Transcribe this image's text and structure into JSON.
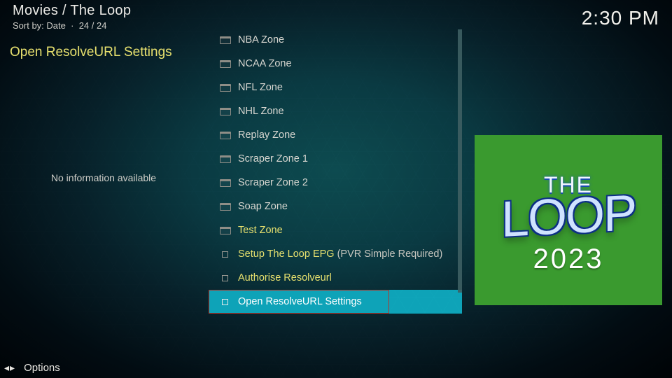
{
  "header": {
    "breadcrumb": "Movies / The Loop",
    "sort_prefix": "Sort by: ",
    "sort_field": "Date",
    "count": "24 / 24"
  },
  "clock": "2:30 PM",
  "left": {
    "title": "Open ResolveURL Settings",
    "no_info": "No information available"
  },
  "list": {
    "items": [
      {
        "label": "NBA Zone",
        "icon": "folder",
        "accent": false,
        "extra": ""
      },
      {
        "label": "NCAA Zone",
        "icon": "folder",
        "accent": false,
        "extra": ""
      },
      {
        "label": "NFL Zone",
        "icon": "folder",
        "accent": false,
        "extra": ""
      },
      {
        "label": "NHL Zone",
        "icon": "folder",
        "accent": false,
        "extra": ""
      },
      {
        "label": "Replay Zone",
        "icon": "folder",
        "accent": false,
        "extra": ""
      },
      {
        "label": "Scraper Zone 1",
        "icon": "folder",
        "accent": false,
        "extra": ""
      },
      {
        "label": "Scraper Zone 2",
        "icon": "folder",
        "accent": false,
        "extra": ""
      },
      {
        "label": "Soap Zone",
        "icon": "folder",
        "accent": false,
        "extra": ""
      },
      {
        "label": "Test Zone",
        "icon": "folder",
        "accent": true,
        "extra": ""
      },
      {
        "label": "Setup The Loop EPG",
        "icon": "square",
        "accent": true,
        "extra": "(PVR Simple Required)"
      },
      {
        "label": "Authorise Resolveurl",
        "icon": "square",
        "accent": true,
        "extra": ""
      },
      {
        "label": "Open ResolveURL Settings",
        "icon": "square",
        "accent": false,
        "extra": "",
        "selected": true
      }
    ]
  },
  "poster": {
    "line1": "THE",
    "line2": "LOOP",
    "line3": "2023"
  },
  "footer": {
    "options_label": "Options"
  },
  "colors": {
    "accent": "#e7e06e",
    "select_bg": "#0ea3b8",
    "select_outline": "#b0362b"
  }
}
